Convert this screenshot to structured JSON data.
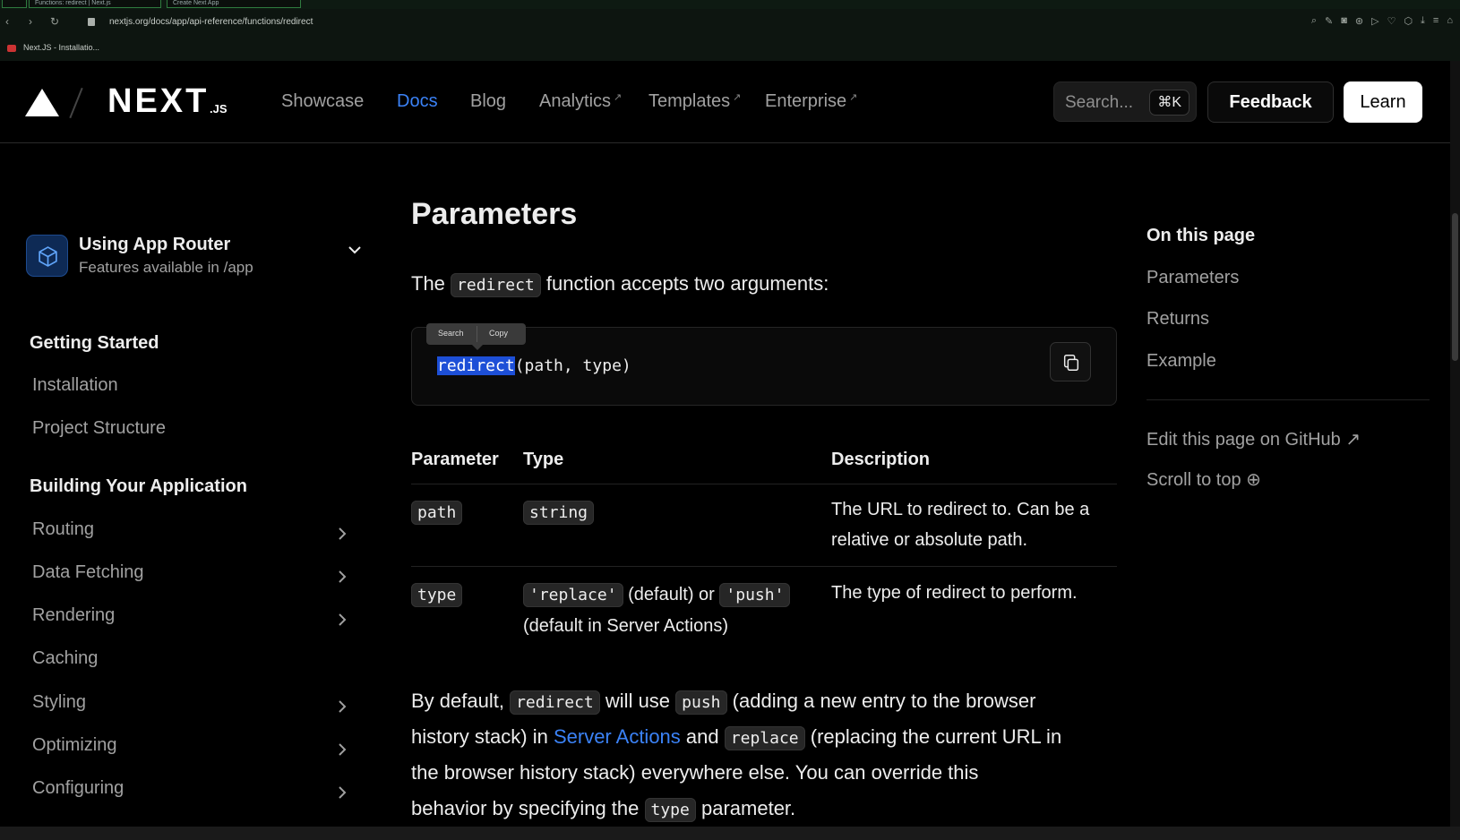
{
  "browser": {
    "tabs": [
      "Functions: redirect | Next.js",
      "Create Next App"
    ],
    "url": "nextjs.org/docs/app/api-reference/functions/redirect",
    "bookmark": "Next.JS - Installatio..."
  },
  "header": {
    "logo_text": "NEXT",
    "logo_suffix": ".JS",
    "nav": [
      {
        "label": "Showcase",
        "external": false,
        "active": false
      },
      {
        "label": "Docs",
        "external": false,
        "active": true
      },
      {
        "label": "Blog",
        "external": false,
        "active": false
      },
      {
        "label": "Analytics",
        "external": true,
        "active": false
      },
      {
        "label": "Templates",
        "external": true,
        "active": false
      },
      {
        "label": "Enterprise",
        "external": true,
        "active": false
      }
    ],
    "search_placeholder": "Search...",
    "search_shortcut": "⌘K",
    "feedback_label": "Feedback",
    "learn_label": "Learn"
  },
  "sidebar": {
    "router_title": "Using App Router",
    "router_subtitle": "Features available in /app",
    "sections": [
      {
        "heading": "Getting Started",
        "items": [
          {
            "label": "Installation",
            "expandable": false
          },
          {
            "label": "Project Structure",
            "expandable": false
          }
        ]
      },
      {
        "heading": "Building Your Application",
        "items": [
          {
            "label": "Routing",
            "expandable": true
          },
          {
            "label": "Data Fetching",
            "expandable": true
          },
          {
            "label": "Rendering",
            "expandable": true
          },
          {
            "label": "Caching",
            "expandable": false
          },
          {
            "label": "Styling",
            "expandable": true
          },
          {
            "label": "Optimizing",
            "expandable": true
          },
          {
            "label": "Configuring",
            "expandable": true
          }
        ]
      }
    ]
  },
  "main": {
    "heading": "Parameters",
    "intro": {
      "before": "The",
      "code": "redirect",
      "after": "function accepts two arguments:"
    },
    "code_block": {
      "selected": "redirect",
      "rest": "(path, type)"
    },
    "selection_popup": {
      "search": "Search",
      "copy": "Copy"
    },
    "table": {
      "headers": [
        "Parameter",
        "Type",
        "Description"
      ],
      "rows": [
        {
          "param": "path",
          "type_code": "string",
          "description": "The URL to redirect to. Can be a relative or absolute path."
        },
        {
          "param": "type",
          "type_code_1": "'replace'",
          "type_text_1": "(default) or",
          "type_code_2": "'push'",
          "type_text_2": "(default in Server Actions)",
          "description": "The type of redirect to perform."
        }
      ]
    },
    "paragraph": {
      "t1": "By default,",
      "c1": "redirect",
      "t2": "will use",
      "c2": "push",
      "t3": "(adding a new entry to the browser",
      "t4": "history stack) in",
      "link": "Server Actions",
      "t5": "and",
      "c3": "replace",
      "t6": "(replacing the current URL in",
      "t7": "the browser history stack) everywhere else. You can override this",
      "t8": "behavior by specifying the",
      "c4": "type",
      "t9": "parameter."
    }
  },
  "toc": {
    "title": "On this page",
    "items": [
      "Parameters",
      "Returns",
      "Example"
    ],
    "edit_label": "Edit this page on GitHub",
    "scroll_label": "Scroll to top"
  }
}
